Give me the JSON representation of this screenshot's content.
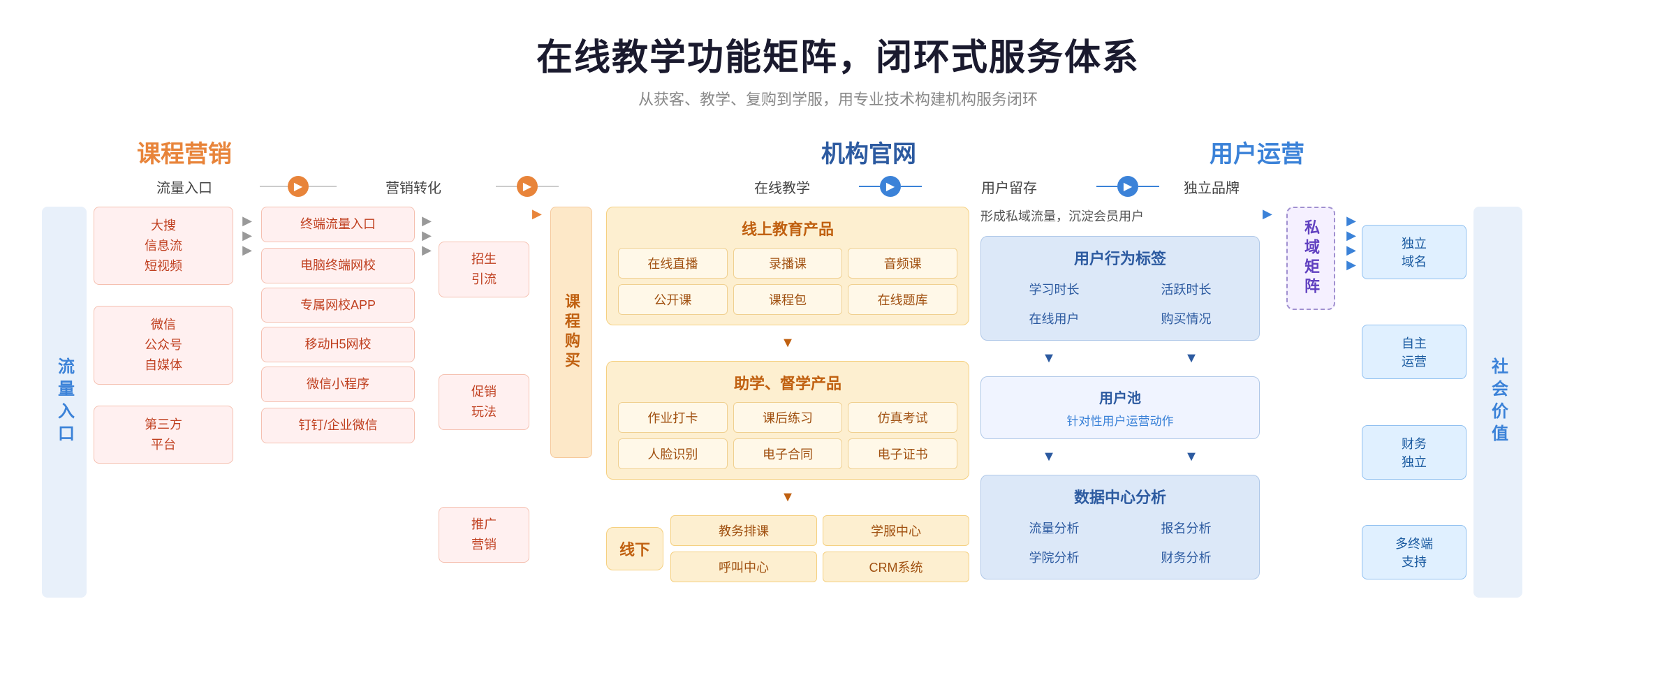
{
  "header": {
    "title": "在线教学功能矩阵，闭环式服务体系",
    "subtitle": "从获客、教学、复购到学服，用专业技术构建机构服务闭环"
  },
  "categories": {
    "marketing": "课程营销",
    "website": "机构官网",
    "user_ops": "用户运营"
  },
  "flow_labels": {
    "traffic": "流量入口",
    "conversion": "营销转化",
    "online_teaching": "在线教学",
    "user_retention": "用户留存",
    "brand": "独立品牌"
  },
  "left_label": "流量入口",
  "right_label": "社会价值",
  "traffic_sources": [
    {
      "lines": [
        "大搜",
        "信息流",
        "短视频"
      ]
    },
    {
      "lines": [
        "微信",
        "公众号",
        "自媒体"
      ]
    },
    {
      "lines": [
        "第三方",
        "平台"
      ]
    }
  ],
  "marketing_items": [
    {
      "text": "终端流量入口"
    },
    {
      "text": "电脑终端网校"
    },
    {
      "text": "专属网校APP"
    },
    {
      "text": "移动H5网校"
    },
    {
      "text": "微信小程序"
    },
    {
      "text": "钉钉/企业微信"
    }
  ],
  "action_items": [
    {
      "text": "招生\n引流"
    },
    {
      "text": "促销\n玩法"
    },
    {
      "text": "推广\n营销"
    }
  ],
  "course_buy_label": "课程购买",
  "online_teaching": {
    "product_title": "线上教育产品",
    "products": [
      "在线直播",
      "录播课",
      "音频课",
      "公开课",
      "课程包",
      "在线题库"
    ],
    "assist_title": "助学、督学产品",
    "assists": [
      "作业打卡",
      "课后练习",
      "仿真考试",
      "人脸识别",
      "电子合同",
      "电子证书"
    ],
    "offline_label": "线下",
    "offline_items": [
      "教务排课",
      "学服中心",
      "呼叫中心",
      "CRM系统"
    ]
  },
  "retention": {
    "header_text": "形成私域流量，沉淀会员用户",
    "user_tag_title": "用户行为标签",
    "tags": [
      "学习时长",
      "活跃时长",
      "在线用户",
      "购买情况"
    ],
    "user_pool_title": "用户池",
    "user_pool_sub": "针对性用户运营动作",
    "data_center_title": "数据中心分析",
    "data_items": [
      "流量分析",
      "报名分析",
      "学院分析",
      "财务分析"
    ]
  },
  "private_domain_label": "私域矩阵",
  "brand_items": [
    {
      "text": "独立\n域名"
    },
    {
      "text": "自主\n运营"
    },
    {
      "text": "财务\n独立"
    },
    {
      "text": "多终端\n支持"
    }
  ]
}
